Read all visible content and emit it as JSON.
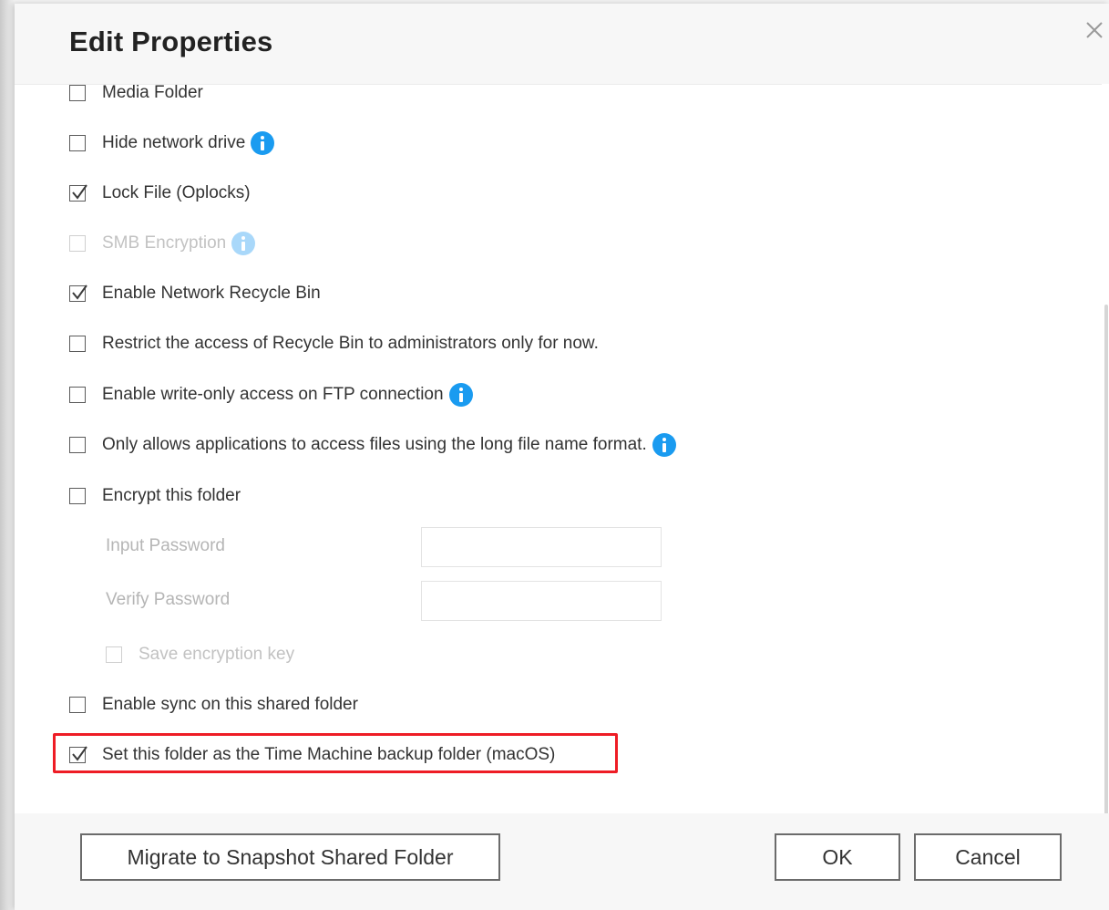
{
  "dialog": {
    "title": "Edit Properties"
  },
  "options": [
    {
      "label": "Media Folder",
      "checked": false,
      "disabled": false,
      "info": false
    },
    {
      "label": "Hide network drive",
      "checked": false,
      "disabled": false,
      "info": true
    },
    {
      "label": "Lock File (Oplocks)",
      "checked": true,
      "disabled": false,
      "info": false
    },
    {
      "label": "SMB Encryption",
      "checked": false,
      "disabled": true,
      "info": true
    },
    {
      "label": "Enable Network Recycle Bin",
      "checked": true,
      "disabled": false,
      "info": false
    },
    {
      "label": "Restrict the access of Recycle Bin to administrators only for now.",
      "checked": false,
      "disabled": false,
      "info": false
    },
    {
      "label": "Enable write-only access on FTP connection",
      "checked": false,
      "disabled": false,
      "info": true
    },
    {
      "label": "Only allows applications to access files using the long file name format.",
      "checked": false,
      "disabled": false,
      "info": true
    },
    {
      "label": "Encrypt this folder",
      "checked": false,
      "disabled": false,
      "info": false
    }
  ],
  "encryption": {
    "input_password_label": "Input Password",
    "input_password_value": "",
    "verify_password_label": "Verify Password",
    "verify_password_value": "",
    "save_key_label": "Save encryption key",
    "save_key_checked": false
  },
  "options_bottom": [
    {
      "label": "Enable sync on this shared folder",
      "checked": false
    },
    {
      "label": "Set this folder as the Time Machine backup folder (macOS)",
      "checked": true
    }
  ],
  "footer": {
    "migrate_label": "Migrate to Snapshot Shared Folder",
    "ok_label": "OK",
    "cancel_label": "Cancel"
  },
  "colors": {
    "info_icon": "#1a9bf0",
    "highlight_border": "#ee1c25"
  },
  "icons": {
    "close": "close-icon",
    "info": "info-icon",
    "check": "checkmark-icon"
  }
}
